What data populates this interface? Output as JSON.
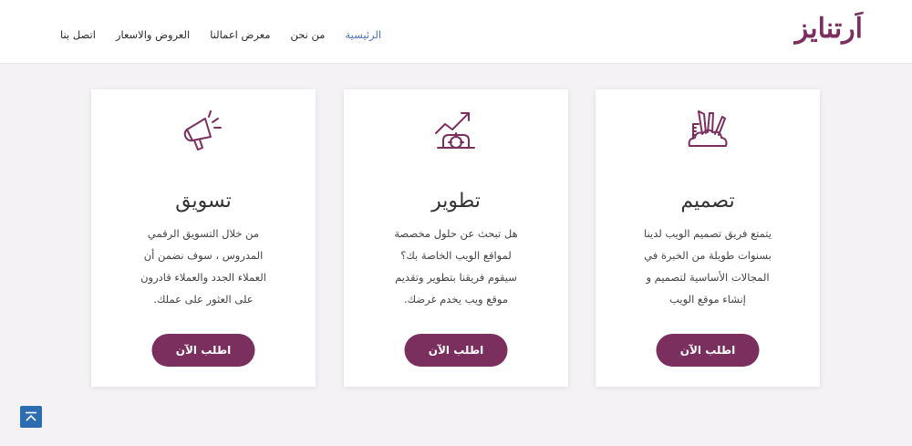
{
  "brand": {
    "logo_text": "اَرتنايز",
    "accent": "#7a2f5e",
    "link_active": "#4a73b8"
  },
  "nav": [
    {
      "label": "الرئيسية",
      "active": true
    },
    {
      "label": "من نحن"
    },
    {
      "label": "معرض اعمالنا"
    },
    {
      "label": "العروض والاسعار"
    },
    {
      "label": "اتصل بنا"
    }
  ],
  "cards": [
    {
      "icon": "design-tools-icon",
      "title": "تصميم",
      "lines": [
        "يتمتع فريق تصميم الويب لدينا",
        "بسنوات طويلة من الخبرة في",
        "المجالات الأساسية لتصميم و",
        "إنشاء موقع الويب"
      ],
      "button": "اطلب الآن"
    },
    {
      "icon": "development-growth-icon",
      "title": "تطوير",
      "lines": [
        "هل تبحث عن حلول مخصصة",
        "لمواقع الويب الخاصة بك؟",
        "سيقوم فريقنا بتطوير وتقديم",
        "موقع ويب يخدم غرضك."
      ],
      "button": "اطلب الآن"
    },
    {
      "icon": "megaphone-icon",
      "title": "تسويق",
      "lines": [
        "من خلال التسويق الرقمي",
        "المدروس ، سوف نضمن أن",
        "العملاء الجدد والعملاء قادرون",
        "على العثور على عملك."
      ],
      "button": "اطلب الآن"
    }
  ],
  "scroll_top": {
    "icon": "arrow-up-icon"
  }
}
